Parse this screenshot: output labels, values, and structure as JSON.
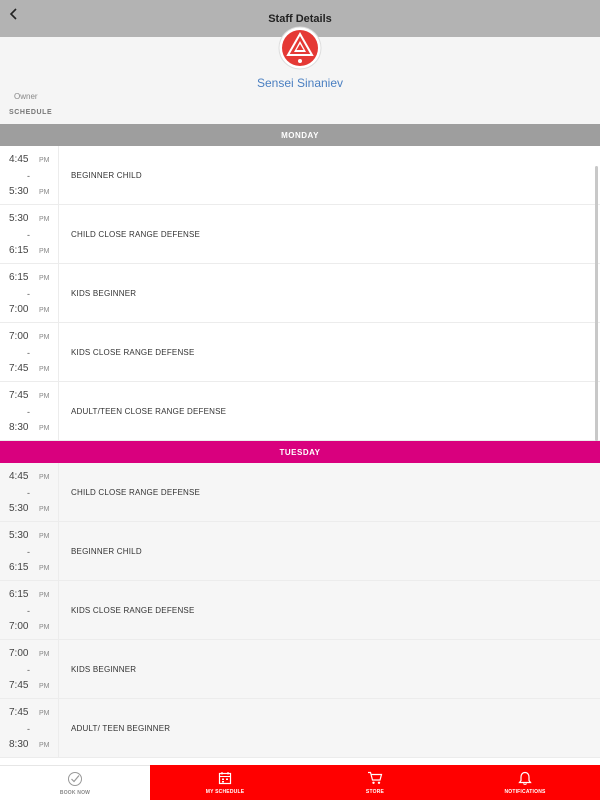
{
  "nav": {
    "title": "Staff Details",
    "back_icon": "chevron-left-icon"
  },
  "staff": {
    "name": "Sensei Sinaniev",
    "role": "Owner",
    "schedule_label": "SCHEDULE"
  },
  "colors": {
    "monday_header": "#9e9e9e",
    "tuesday_header": "#d9007e",
    "tab_accent": "#ff0000",
    "name_link": "#4a7fc1"
  },
  "days": [
    {
      "name": "MONDAY",
      "classes": [
        {
          "start": "4:45",
          "start_ampm": "PM",
          "end": "5:30",
          "end_ampm": "PM",
          "name": "BEGINNER CHILD"
        },
        {
          "start": "5:30",
          "start_ampm": "PM",
          "end": "6:15",
          "end_ampm": "PM",
          "name": "CHILD CLOSE RANGE DEFENSE"
        },
        {
          "start": "6:15",
          "start_ampm": "PM",
          "end": "7:00",
          "end_ampm": "PM",
          "name": "KIDS BEGINNER"
        },
        {
          "start": "7:00",
          "start_ampm": "PM",
          "end": "7:45",
          "end_ampm": "PM",
          "name": "KIDS CLOSE RANGE DEFENSE"
        },
        {
          "start": "7:45",
          "start_ampm": "PM",
          "end": "8:30",
          "end_ampm": "PM",
          "name": "ADULT/TEEN CLOSE RANGE DEFENSE"
        }
      ]
    },
    {
      "name": "TUESDAY",
      "classes": [
        {
          "start": "4:45",
          "start_ampm": "PM",
          "end": "5:30",
          "end_ampm": "PM",
          "name": "CHILD CLOSE RANGE DEFENSE"
        },
        {
          "start": "5:30",
          "start_ampm": "PM",
          "end": "6:15",
          "end_ampm": "PM",
          "name": "BEGINNER CHILD"
        },
        {
          "start": "6:15",
          "start_ampm": "PM",
          "end": "7:00",
          "end_ampm": "PM",
          "name": "KIDS CLOSE RANGE DEFENSE"
        },
        {
          "start": "7:00",
          "start_ampm": "PM",
          "end": "7:45",
          "end_ampm": "PM",
          "name": "KIDS BEGINNER"
        },
        {
          "start": "7:45",
          "start_ampm": "PM",
          "end": "8:30",
          "end_ampm": "PM",
          "name": "ADULT/ TEEN BEGINNER"
        }
      ]
    }
  ],
  "tabs": [
    {
      "label": "BOOK NOW",
      "icon": "check-circle-icon"
    },
    {
      "label": "MY SCHEDULE",
      "icon": "calendar-icon"
    },
    {
      "label": "STORE",
      "icon": "cart-icon"
    },
    {
      "label": "NOTIFICATIONS",
      "icon": "bell-icon"
    }
  ]
}
